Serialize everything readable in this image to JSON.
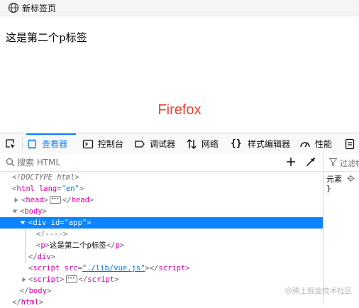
{
  "browser_tab": {
    "title": "新标签页",
    "icon": "globe-icon"
  },
  "page": {
    "paragraph_text": "这是第二个p标签",
    "brand_text": "Firefox",
    "brand_color": "#e8412f"
  },
  "devtools": {
    "tabs": [
      {
        "label": "查看器",
        "icon": "inspector-icon",
        "active": true
      },
      {
        "label": "控制台",
        "icon": "console-icon"
      },
      {
        "label": "调试器",
        "icon": "debugger-icon"
      },
      {
        "label": "网络",
        "icon": "network-icon"
      },
      {
        "label": "样式编辑器",
        "icon": "style-editor-icon"
      },
      {
        "label": "性能",
        "icon": "performance-icon"
      }
    ],
    "accent_color": "#0a84ff",
    "search_placeholder": "搜索 HTML",
    "filter_placeholder": "过滤样式",
    "rules": {
      "element_label": "元素",
      "closing_brace": "}"
    },
    "markup": {
      "doctype": "<!DOCTYPE html>",
      "html_tag": "html",
      "html_attr": "lang",
      "html_val": "\"en\"",
      "head_tag": "head",
      "body_tag": "body",
      "div_tag": "div",
      "div_attr": "id",
      "div_val": "\"app\"",
      "comment": "<!---->",
      "p_tag": "p",
      "p_text": "这是第二个p标签",
      "script_tag": "script",
      "script_attr": "src",
      "script_val": "\"./lib/vue.js\""
    }
  },
  "watermark": "@稀土掘金技术社区"
}
